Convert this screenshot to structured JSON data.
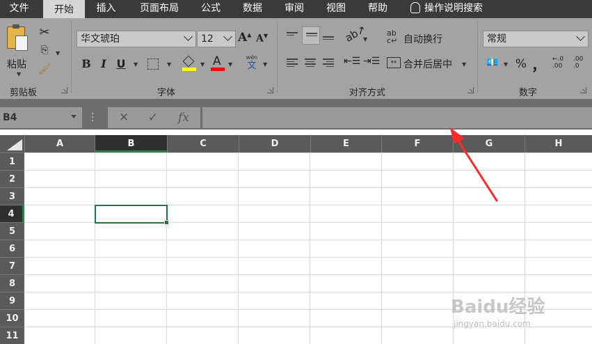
{
  "menu": {
    "tabs": [
      "文件",
      "开始",
      "插入",
      "页面布局",
      "公式",
      "数据",
      "审阅",
      "视图",
      "帮助"
    ],
    "search_label": "操作说明搜索",
    "active_tab": "开始"
  },
  "ribbon": {
    "clipboard": {
      "paste_label": "粘贴",
      "group_label": "剪贴板"
    },
    "font": {
      "font_name": "华文琥珀",
      "font_size": "12",
      "grow_label": "A",
      "shrink_label": "A",
      "bold": "B",
      "italic": "I",
      "underline": "U",
      "font_color_glyph": "A",
      "phonetic_top": "wén",
      "phonetic_bottom": "文",
      "group_label": "字体"
    },
    "alignment": {
      "wrap_text": "自动换行",
      "merge_center": "合并后居中",
      "group_label": "对齐方式"
    },
    "number": {
      "format": "常规",
      "percent": "%",
      "comma": "，",
      "inc_decimal": ".00",
      "dec_decimal": ".0",
      "group_label": "数字"
    }
  },
  "formula_bar": {
    "name_box": "B4",
    "cancel": "✕",
    "enter": "✓",
    "fx": "fx",
    "formula": ""
  },
  "grid": {
    "columns": [
      "A",
      "B",
      "C",
      "D",
      "E",
      "F",
      "G",
      "H"
    ],
    "rows": [
      "1",
      "2",
      "3",
      "4",
      "5",
      "6",
      "7",
      "8",
      "9",
      "10",
      "11"
    ],
    "selected_column": "B",
    "selected_row": "4"
  },
  "colors": {
    "accent": "#217346",
    "annotation_arrow": "#ff2a2a",
    "menubar": "#3a3a3a",
    "ribbon": "#a3a3a3"
  },
  "watermark": {
    "logo": "Baidu经验",
    "url": "jingyan.baidu.com"
  }
}
